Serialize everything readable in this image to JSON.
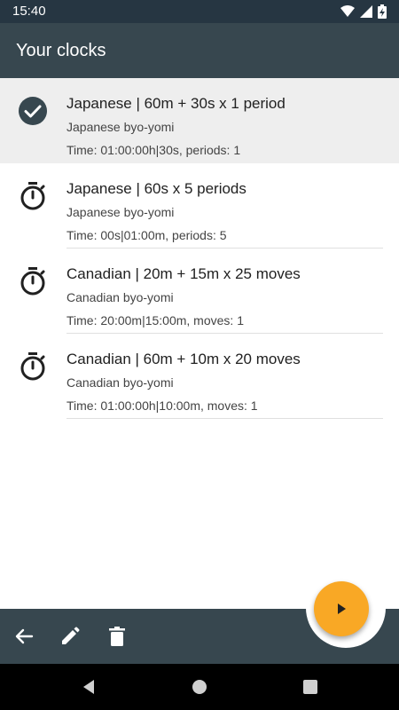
{
  "status_bar": {
    "time": "15:40"
  },
  "app_bar": {
    "title": "Your clocks"
  },
  "clocks": [
    {
      "title": "Japanese | 60m + 30s x 1 period",
      "subtitle": "Japanese byo-yomi",
      "detail": "Time: 01:00:00h|30s, periods: 1",
      "selected": true,
      "icon": "check-circle-icon"
    },
    {
      "title": "Japanese | 60s x 5 periods",
      "subtitle": "Japanese byo-yomi",
      "detail": "Time: 00s|01:00m, periods: 5",
      "selected": false,
      "icon": "stopwatch-icon"
    },
    {
      "title": "Canadian | 20m + 15m x 25 moves",
      "subtitle": "Canadian byo-yomi",
      "detail": "Time: 20:00m|15:00m, moves: 1",
      "selected": false,
      "icon": "stopwatch-icon"
    },
    {
      "title": "Canadian | 60m + 10m x 20 moves",
      "subtitle": "Canadian byo-yomi",
      "detail": "Time: 01:00:00h|10:00m, moves: 1",
      "selected": false,
      "icon": "stopwatch-icon"
    }
  ],
  "bottom_bar": {
    "actions": [
      "back-arrow-icon",
      "edit-pencil-icon",
      "delete-trash-icon"
    ]
  },
  "fab": {
    "icon": "play-icon",
    "color": "#f9a825"
  },
  "colors": {
    "primary": "#37474f",
    "status_bar": "#263642",
    "selected_row": "#eeeeee",
    "accent": "#f9a825"
  }
}
